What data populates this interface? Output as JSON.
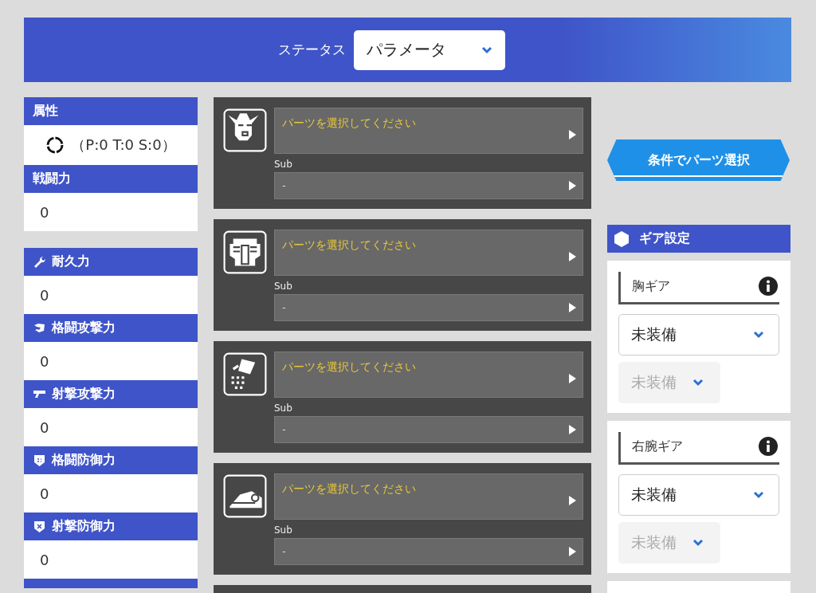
{
  "header": {
    "label": "ステータス",
    "select": "パラメータ"
  },
  "stats": {
    "groups": [
      [
        {
          "kind": "attribute",
          "title": "属性",
          "value": "（P:0 T:0 S:0）"
        },
        {
          "kind": "plain",
          "title": "戦闘力",
          "value": "0"
        }
      ],
      [
        {
          "kind": "wrench",
          "title": "耐久力",
          "value": "0"
        },
        {
          "kind": "fist",
          "title": "格闘攻撃力",
          "value": "0"
        },
        {
          "kind": "gun",
          "title": "射撃攻撃力",
          "value": "0"
        },
        {
          "kind": "shield-grid",
          "title": "格闘防御力",
          "value": "0"
        },
        {
          "kind": "shield-x",
          "title": "射撃防御力",
          "value": "0"
        }
      ]
    ]
  },
  "parts": [
    {
      "kind": "head",
      "value": "パーツを選択してください",
      "sub_label": "Sub",
      "sub_value": "-"
    },
    {
      "kind": "body",
      "value": "パーツを選択してください",
      "sub_label": "Sub",
      "sub_value": "-"
    },
    {
      "kind": "arm",
      "value": "パーツを選択してください",
      "sub_label": "Sub",
      "sub_value": "-"
    },
    {
      "kind": "leg",
      "value": "パーツを選択してください",
      "sub_label": "Sub",
      "sub_value": "-"
    }
  ],
  "filter_button": "条件でパーツ選択",
  "gear": {
    "title": "ギア設定",
    "items": [
      {
        "label": "胸ギア",
        "select": "未装備",
        "sub_select": "未装備",
        "sub_disabled": true
      },
      {
        "label": "右腕ギア",
        "select": "未装備",
        "sub_select": "未装備",
        "sub_disabled": true
      }
    ]
  }
}
